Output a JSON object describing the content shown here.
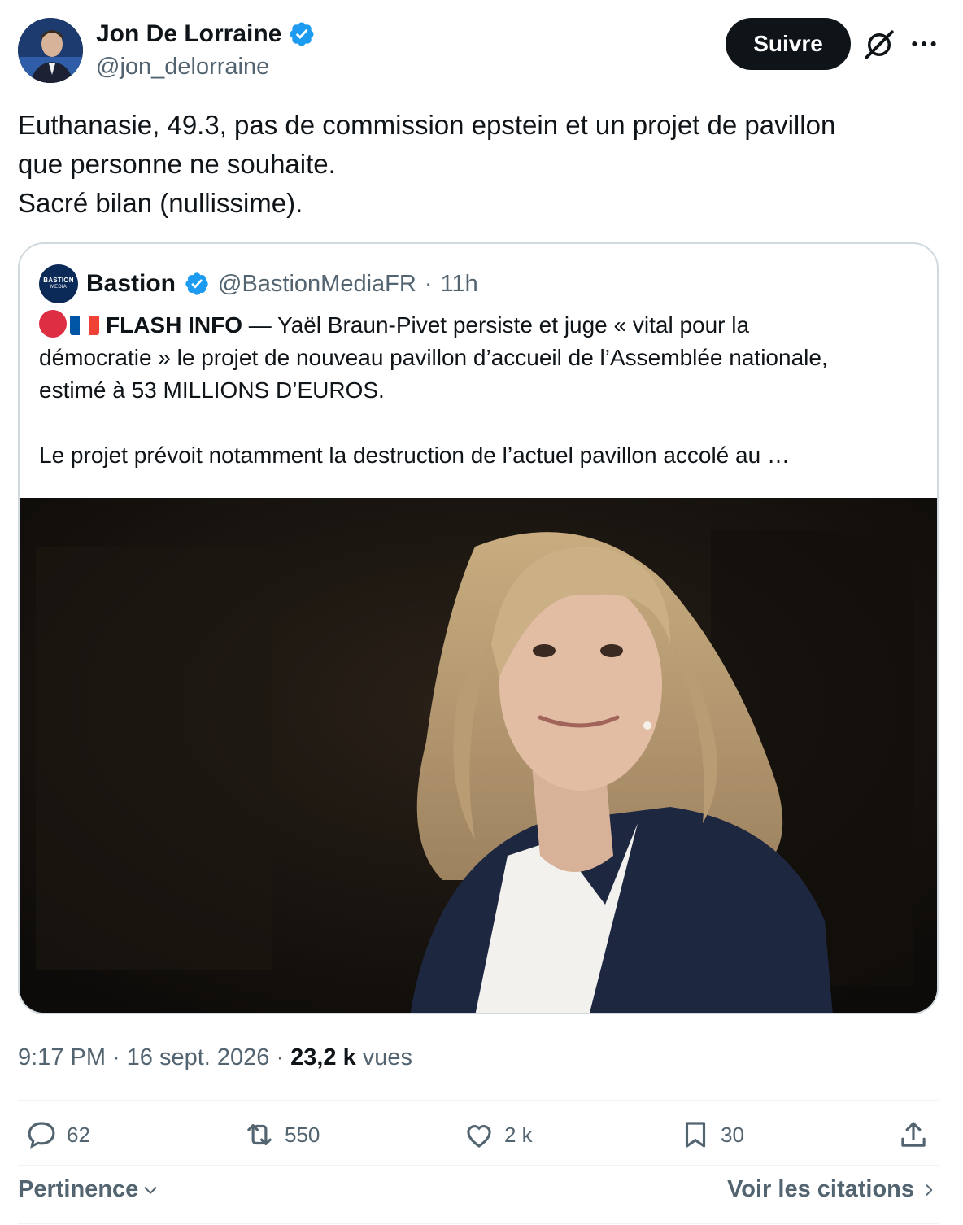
{
  "author": {
    "name": "Jon De Lorraine",
    "handle": "@jon_delorraine",
    "verified": true
  },
  "follow_button": "Suivre",
  "tweet": {
    "lines": [
      "Euthanasie, 49.3, pas de commission epstein et un projet de pavillon",
      "que personne ne souhaite.",
      "Sacré bilan (nullissime)."
    ]
  },
  "quoted": {
    "avatar_text": "BASTION",
    "avatar_subtext": "MEDIA",
    "name": "Bastion",
    "handle": "@BastionMediaFR",
    "separator": "·",
    "time": "11h",
    "flash_label": "FLASH INFO",
    "line1_rest": " — Yaël Braun-Pivet persiste et juge « vital pour la",
    "line2": "démocratie » le projet de nouveau pavillon d’accueil de l’Assemblée nationale,",
    "line3": "estimé à 53 MILLIONS D’EUROS.",
    "line4": "Le projet prévoit notamment la destruction de l’actuel pavillon accolé au …"
  },
  "meta": {
    "time": "9:17 PM",
    "sep1": "·",
    "date": "16 sept. 2026",
    "sep2": "·",
    "views_count": "23,2 k",
    "views_label": "vues"
  },
  "actions": {
    "replies": "62",
    "reposts": "550",
    "likes": "2 k",
    "bookmarks": "30"
  },
  "footer": {
    "sort_label": "Pertinence",
    "quotes_link": "Voir les citations"
  },
  "colors": {
    "verified_blue": "#1d9bf0",
    "text_primary": "#0f1419",
    "text_secondary": "#536471",
    "border": "#cfd9de"
  }
}
